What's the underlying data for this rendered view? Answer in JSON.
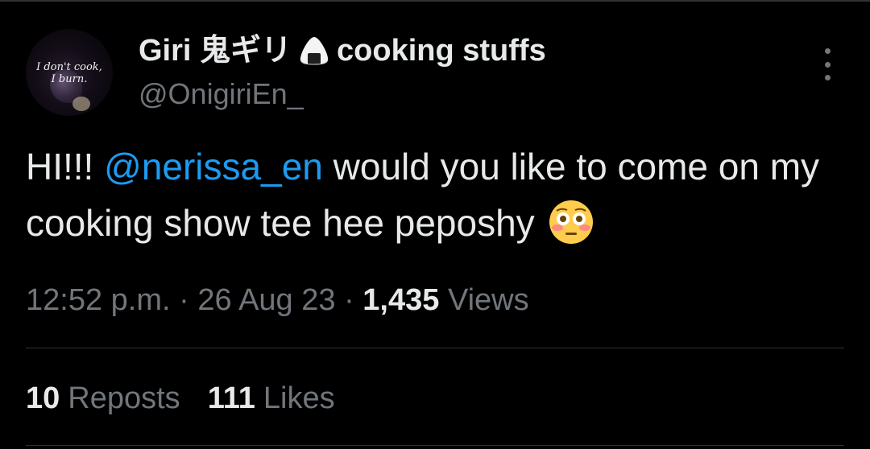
{
  "author": {
    "display_name_prefix": "Giri 鬼ギリ",
    "display_name_suffix": "cooking stuffs",
    "name_icon": "onigiri-icon",
    "handle": "@OnigiriEn_",
    "avatar_text": "I don't cook,\nI burn."
  },
  "tweet": {
    "text_before": "HI!!! ",
    "mention": "@nerissa_en",
    "text_after": " would you like to come on my cooking show tee hee peposhy ",
    "emoji": "flushed-face-emoji"
  },
  "meta": {
    "time": "12:52 p.m.",
    "separator1": " · ",
    "date": "26 Aug 23",
    "separator2": " · ",
    "views_count": "1,435",
    "views_label": " Views"
  },
  "stats": {
    "reposts_count": "10",
    "reposts_label": "Reposts",
    "likes_count": "111",
    "likes_label": "Likes"
  },
  "colors": {
    "background": "#000000",
    "primary_text": "#e7e9ea",
    "secondary_text": "#71767b",
    "link": "#1d9bf0",
    "divider": "#2f3336"
  }
}
